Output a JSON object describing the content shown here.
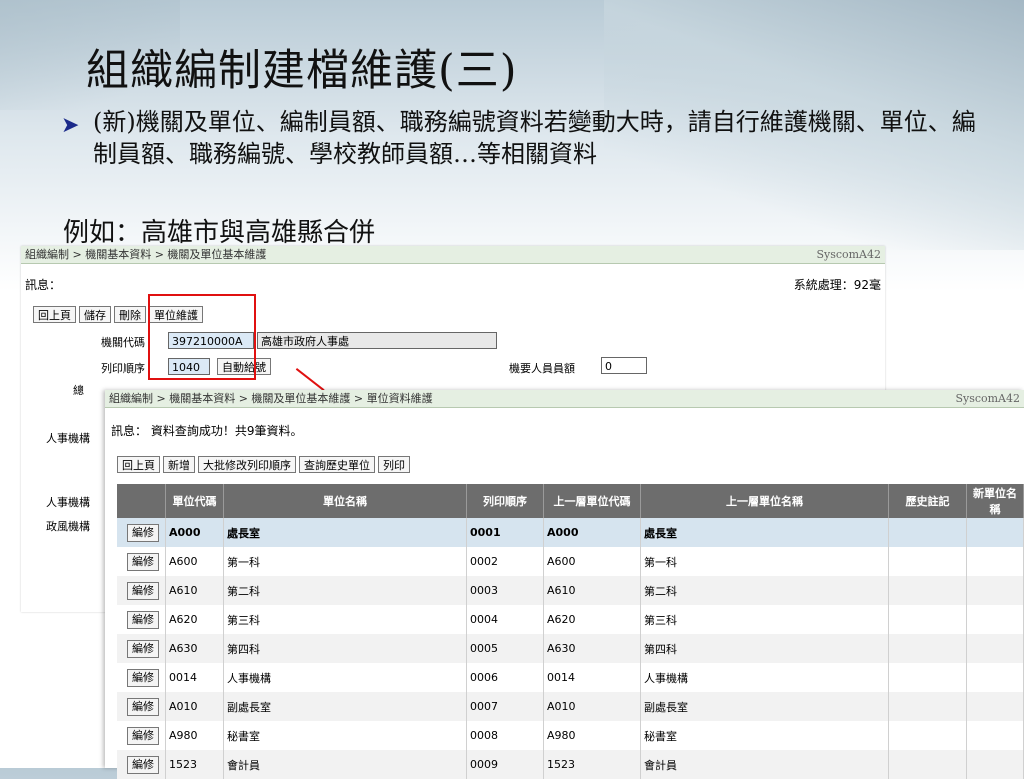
{
  "slide": {
    "title": "組織編制建檔維護(三)",
    "bullet": "(新)機關及單位、編制員額、職務編號資料若變動大時，請自行維護機關、單位、編制員額、職務編號、學校教師員額…等相關資料",
    "example": "例如：高雄市與高雄縣合併"
  },
  "win1": {
    "breadcrumb": "組織編制 > 機關基本資料 > 機關及單位基本維護",
    "system": "SyscomA42",
    "msg_label": "訊息：",
    "status": "系統處理：92毫",
    "buttons": [
      "回上頁",
      "儲存",
      "刪除",
      "單位維護"
    ],
    "org_code_label": "機關代碼",
    "org_code": "397210000A",
    "org_name": "高雄市政府人事處",
    "print_order_label": "列印順序",
    "print_order": "1040",
    "auto_number": "自動給號",
    "staff_quota_label": "機要人員員額",
    "staff_quota": "0",
    "side_labels": [
      "總",
      "人事機構",
      "人事機構",
      "政風機構"
    ]
  },
  "win2": {
    "breadcrumb": "組織編制 > 機關基本資料 > 機關及單位基本維護 > 單位資料維護",
    "system": "SyscomA42",
    "msg_label": "訊息：",
    "msg": "資料查詢成功！共9筆資料。",
    "buttons": [
      "回上頁",
      "新增",
      "大批修改列印順序",
      "查詢歷史單位",
      "列印"
    ],
    "columns": [
      "",
      "單位代碼",
      "單位名稱",
      "列印順序",
      "上一層單位代碼",
      "上一層單位名稱",
      "歷史註記",
      "新單位名稱"
    ],
    "edit_label": "編修",
    "rows": [
      [
        "A000",
        "處長室",
        "0001",
        "A000",
        "處長室"
      ],
      [
        "A600",
        "第一科",
        "0002",
        "A600",
        "第一科"
      ],
      [
        "A610",
        "第二科",
        "0003",
        "A610",
        "第二科"
      ],
      [
        "A620",
        "第三科",
        "0004",
        "A620",
        "第三科"
      ],
      [
        "A630",
        "第四科",
        "0005",
        "A630",
        "第四科"
      ],
      [
        "0014",
        "人事機構",
        "0006",
        "0014",
        "人事機構"
      ],
      [
        "A010",
        "副處長室",
        "0007",
        "A010",
        "副處長室"
      ],
      [
        "A980",
        "秘書室",
        "0008",
        "A980",
        "秘書室"
      ],
      [
        "1523",
        "會計員",
        "0009",
        "1523",
        "會計員"
      ]
    ]
  }
}
